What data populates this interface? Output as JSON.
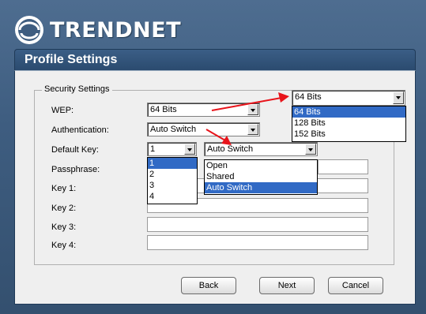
{
  "brand": {
    "name": "TRENDnet",
    "logo_text": "TRENDNET",
    "logo_icon": "trendnet-logo-icon"
  },
  "header": {
    "title": "Profile Settings"
  },
  "group": {
    "legend": "Security Settings"
  },
  "labels": {
    "wep": "WEP:",
    "authentication": "Authentication:",
    "default_key": "Default Key:",
    "passphrase": "Passphrase:",
    "key1": "Key 1:",
    "key2": "Key 2:",
    "key3": "Key 3:",
    "key4": "Key 4:"
  },
  "wep_select": {
    "value": "64 Bits",
    "popup_value": "64 Bits",
    "options": [
      "64 Bits",
      "128 Bits",
      "152 Bits"
    ],
    "selected_index": 0
  },
  "auth_select": {
    "value": "Auto Switch",
    "popup_value": "Auto Switch",
    "options": [
      "Open",
      "Shared",
      "Auto Switch"
    ],
    "selected_index": 2
  },
  "default_key_select": {
    "value": "1",
    "options": [
      "1",
      "2",
      "3",
      "4"
    ],
    "selected_index": 0
  },
  "inputs": {
    "passphrase": "",
    "key1": "",
    "key2": "",
    "key3": "",
    "key4": ""
  },
  "buttons": {
    "back": "Back",
    "next": "Next",
    "cancel": "Cancel"
  },
  "colors": {
    "frame": "#3e5d80",
    "header": "#2f5078",
    "selection": "#316ac5",
    "arrow": "#e8141b"
  },
  "icons": {
    "dropdown": "chevron-down-icon",
    "arrow": "red-arrow-icon"
  }
}
